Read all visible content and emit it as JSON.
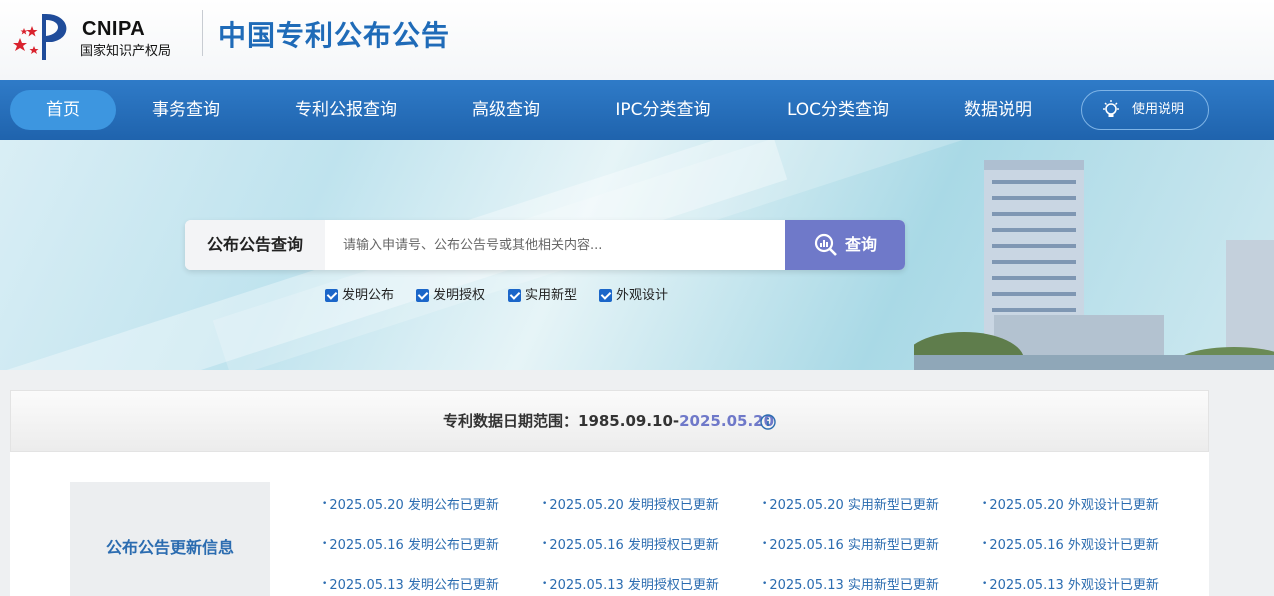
{
  "header": {
    "logo_en": "CNIPA",
    "logo_cn": "国家知识产权局",
    "site_title": "中国专利公布公告"
  },
  "nav": {
    "items": [
      "首页",
      "事务查询",
      "专利公报查询",
      "高级查询",
      "IPC分类查询",
      "LOC分类查询",
      "数据说明"
    ],
    "active": "首页",
    "help_label": "使用说明"
  },
  "search": {
    "label": "公布公告查询",
    "placeholder": "请输入申请号、公布公告号或其他相关内容...",
    "button": "查询",
    "filters": [
      {
        "label": "发明公布",
        "checked": true
      },
      {
        "label": "发明授权",
        "checked": true
      },
      {
        "label": "实用新型",
        "checked": true
      },
      {
        "label": "外观设计",
        "checked": true
      }
    ]
  },
  "range": {
    "prefix": "专利数据日期范围：1985.09.10-",
    "end": "2025.05.20"
  },
  "updates": {
    "title": "公布公告更新信息",
    "rows": [
      [
        "2025.05.20 发明公布已更新",
        "2025.05.20 发明授权已更新",
        "2025.05.20 实用新型已更新",
        "2025.05.20 外观设计已更新"
      ],
      [
        "2025.05.16 发明公布已更新",
        "2025.05.16 发明授权已更新",
        "2025.05.16 实用新型已更新",
        "2025.05.16 外观设计已更新"
      ],
      [
        "2025.05.13 发明公布已更新",
        "2025.05.13 发明授权已更新",
        "2025.05.13 实用新型已更新",
        "2025.05.13 外观设计已更新"
      ]
    ]
  },
  "colors": {
    "brand_blue": "#1f6bb8",
    "nav_blue": "#2f7bc8",
    "accent_purple": "#6f79c9"
  }
}
